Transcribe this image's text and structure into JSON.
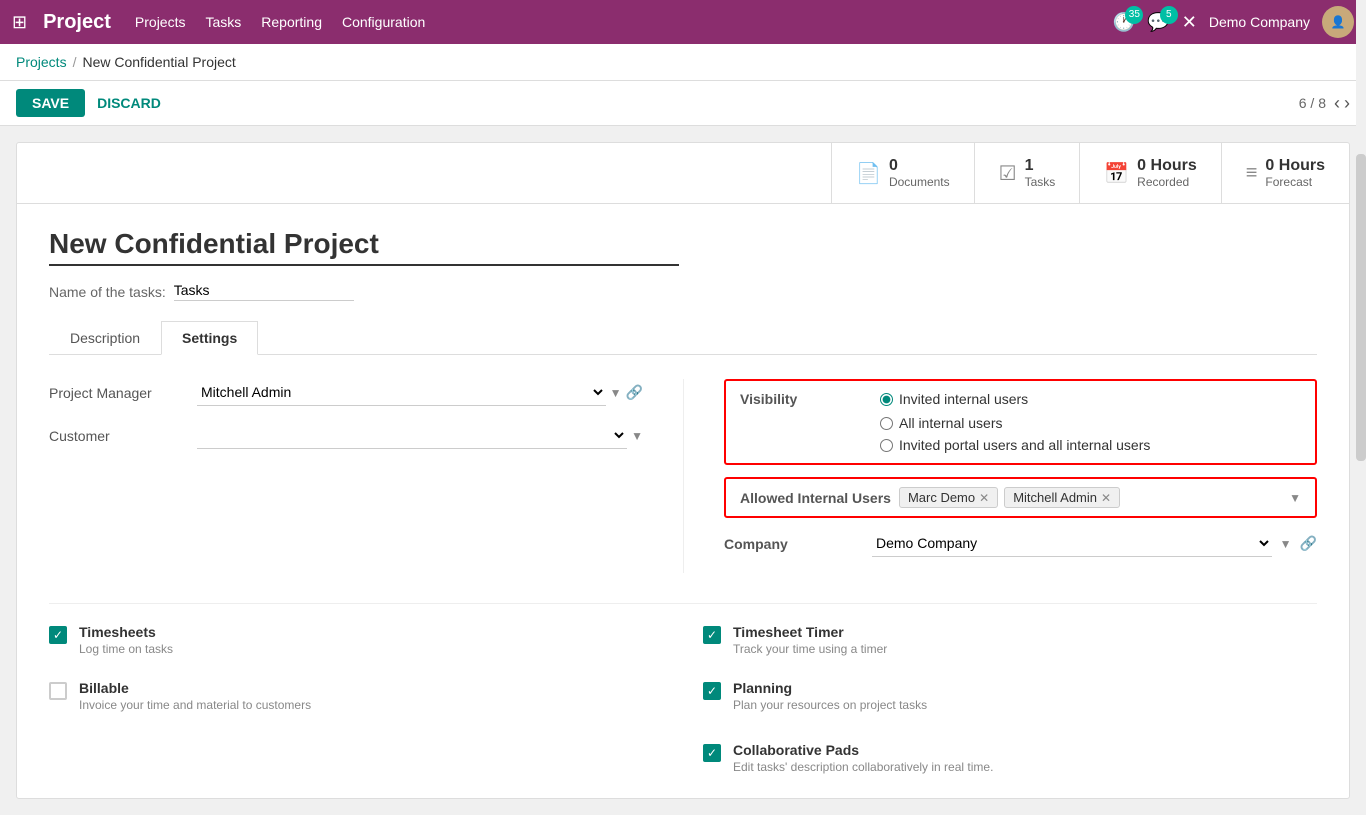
{
  "topnav": {
    "title": "Project",
    "links": [
      "Projects",
      "Tasks",
      "Reporting",
      "Configuration"
    ],
    "badge1_count": "35",
    "badge2_count": "5",
    "company": "Demo Company"
  },
  "breadcrumb": {
    "parent": "Projects",
    "separator": "/",
    "current": "New Confidential Project"
  },
  "action_bar": {
    "save_label": "SAVE",
    "discard_label": "DISCARD",
    "pager": "6 / 8"
  },
  "stats": [
    {
      "icon": "📄",
      "number": "0",
      "label": "Documents"
    },
    {
      "icon": "☑",
      "number": "1",
      "label": "Tasks"
    },
    {
      "icon": "📅",
      "number": "0 Hours",
      "label": "Recorded"
    },
    {
      "icon": "≡",
      "number": "0 Hours",
      "label": "Forecast"
    }
  ],
  "form": {
    "project_name": "New Confidential Project",
    "task_name_label": "Name of the tasks:",
    "task_name_value": "Tasks"
  },
  "tabs": [
    {
      "label": "Description",
      "active": false
    },
    {
      "label": "Settings",
      "active": true
    }
  ],
  "settings": {
    "project_manager_label": "Project Manager",
    "project_manager_value": "Mitchell Admin",
    "customer_label": "Customer",
    "visibility_label": "Visibility",
    "visibility_options": [
      {
        "label": "Invited internal users",
        "selected": true
      },
      {
        "label": "All internal users",
        "selected": false
      },
      {
        "label": "Invited portal users and all internal users",
        "selected": false
      }
    ],
    "allowed_users_label": "Allowed Internal Users",
    "allowed_users": [
      "Marc Demo",
      "Mitchell Admin"
    ],
    "company_label": "Company",
    "company_value": "Demo Company"
  },
  "checkboxes": [
    {
      "checked": true,
      "title": "Timesheets",
      "desc": "Log time on tasks",
      "id": "timesheets"
    },
    {
      "checked": true,
      "title": "Timesheet Timer",
      "desc": "Track your time using a timer",
      "id": "timer"
    },
    {
      "checked": false,
      "title": "Billable",
      "desc": "Invoice your time and material to customers",
      "id": "billable"
    },
    {
      "checked": true,
      "title": "Planning",
      "desc": "Plan your resources on project tasks",
      "id": "planning"
    },
    {
      "checked": true,
      "title": "Collaborative Pads",
      "desc": "Edit tasks' description collaboratively in real time.",
      "id": "collab"
    }
  ]
}
